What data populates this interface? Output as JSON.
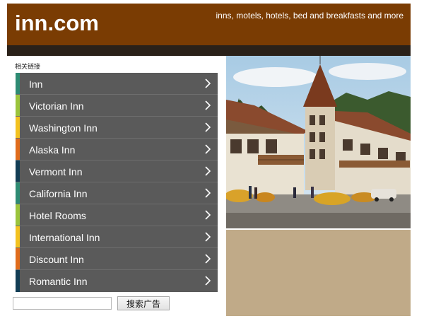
{
  "header": {
    "title": "inn.com",
    "tagline": "inns, motels, hotels, bed and breakfasts and more"
  },
  "links": {
    "title": "相关链接",
    "items": [
      {
        "label": "Inn",
        "accent": "#2e8b73"
      },
      {
        "label": "Victorian Inn",
        "accent": "#9bc43c"
      },
      {
        "label": "Washington Inn",
        "accent": "#f3c21f"
      },
      {
        "label": "Alaska Inn",
        "accent": "#e06c1c"
      },
      {
        "label": "Vermont Inn",
        "accent": "#123d55"
      },
      {
        "label": "California Inn",
        "accent": "#2e8b73"
      },
      {
        "label": "Hotel Rooms",
        "accent": "#9bc43c"
      },
      {
        "label": "International Inn",
        "accent": "#f3c21f"
      },
      {
        "label": "Discount Inn",
        "accent": "#e06c1c"
      },
      {
        "label": "Romantic Inn",
        "accent": "#123d55"
      }
    ]
  },
  "search": {
    "value": "",
    "button_label": "搜索广告"
  },
  "photo": {
    "icon": "village-inn-photo"
  },
  "colors": {
    "header_bg": "#7a3c03",
    "bar_bg": "#2a2119",
    "link_bg": "#5a5a5a",
    "photo_panel_bg": "#c0aa88"
  }
}
